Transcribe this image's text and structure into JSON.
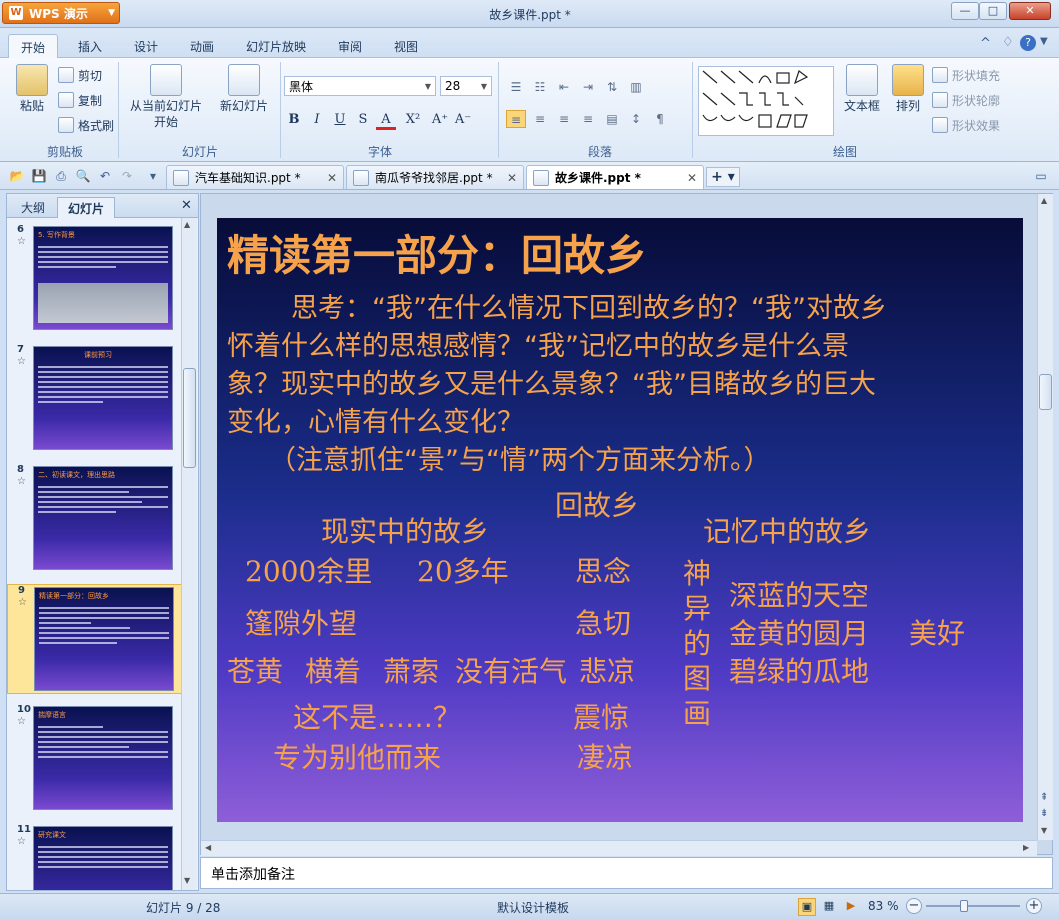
{
  "app": {
    "brand": "WPS 演示",
    "doc_title": "故乡课件.ppt *"
  },
  "menu": {
    "tabs": [
      "开始",
      "插入",
      "设计",
      "动画",
      "幻灯片放映",
      "审阅",
      "视图"
    ]
  },
  "ribbon": {
    "clipboard": {
      "paste": "粘贴",
      "cut": "剪切",
      "copy": "复制",
      "format_painter": "格式刷",
      "label": "剪贴板"
    },
    "slides": {
      "from_current": "从当前幻灯片",
      "start": "开始",
      "new_slide": "新幻灯片",
      "label": "幻灯片"
    },
    "font": {
      "name": "黑体",
      "size": "28",
      "bold": "B",
      "italic": "I",
      "underline": "U",
      "strike": "S",
      "color": "A",
      "superscript": "X²",
      "grow": "A⁺",
      "shrink": "A⁻",
      "label": "字体"
    },
    "paragraph": {
      "label": "段落"
    },
    "drawing": {
      "textbox": "文本框",
      "arrange": "排列",
      "shape_fill": "形状填充",
      "shape_outline": "形状轮廓",
      "shape_effect": "形状效果",
      "label": "绘图"
    }
  },
  "doc_tabs": [
    {
      "label": "汽车基础知识.ppt *"
    },
    {
      "label": "南瓜爷爷找邻居.ppt *"
    },
    {
      "label": "故乡课件.ppt *"
    }
  ],
  "left_panel": {
    "tab_outline": "大纲",
    "tab_slides": "幻灯片",
    "thumbs": [
      {
        "num": "6",
        "title": "5. 写作背景"
      },
      {
        "num": "7",
        "title": "课前预习"
      },
      {
        "num": "8",
        "title": "二、初读课文，理出思路"
      },
      {
        "num": "9",
        "title": "精读第一部分：回故乡"
      },
      {
        "num": "10",
        "title": "揣摩语言"
      },
      {
        "num": "11",
        "title": "研究课文"
      }
    ]
  },
  "slide": {
    "title": "精读第一部分：回故乡",
    "lines": [
      "思考：“我”在什么情况下回到故乡的？“我”对故乡",
      "怀着什么样的思想感情？“我”记忆中的故乡是什么景",
      "象？现实中的故乡又是什么景象？“我”目睹故乡的巨大",
      "变化，心情有什么变化？",
      "（注意抓住“景”与“情”两个方面来分析。）"
    ],
    "center_title": "回故乡",
    "left_header": "现实中的故乡",
    "right_header": "记忆中的故乡",
    "left_items": [
      "2000余里",
      "20多年",
      "篷隙外望",
      "苍黄",
      "横着",
      "萧索",
      "没有活气",
      "这不是……？",
      "专为别他而来"
    ],
    "middle_items": [
      "思念",
      "急切",
      "悲凉",
      "震惊",
      "凄凉"
    ],
    "vertical_text": [
      "神",
      "异",
      "的",
      "图",
      "画"
    ],
    "right_items": [
      "深蓝的天空",
      "金黄的圆月",
      "碧绿的瓜地",
      "美好"
    ]
  },
  "notes": {
    "placeholder": "单击添加备注"
  },
  "status": {
    "slide_counter": "幻灯片 9 / 28",
    "template": "默认设计模板",
    "zoom": "83 %",
    "zoom_fraction": 0.83
  }
}
